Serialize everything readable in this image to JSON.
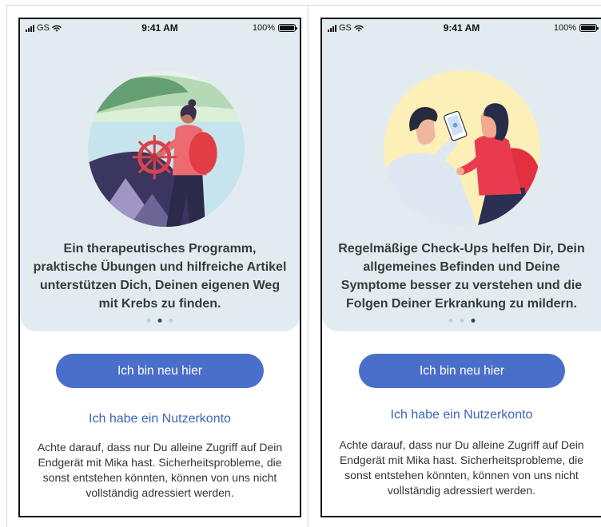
{
  "colors": {
    "accent": "#4a6fcb",
    "link": "#3f63ba",
    "card_background": "#e2ecf0",
    "dot_active": "#394755",
    "dot_inactive": "#c5cdd2",
    "text": "#3a3a3a"
  },
  "icons": {
    "signal": "signal-bars-icon",
    "wifi": "wifi-icon",
    "battery": "battery-icon"
  },
  "screens": [
    {
      "status_bar": {
        "carrier": "GS",
        "time": "9:41 AM",
        "battery": "100%"
      },
      "headline_lines": [
        "Ein therapeutisches Programm,",
        "praktische Übungen und hilfreiche Artikel",
        "unterstützen Dich, Deinen eigenen Weg",
        "mit Krebs zu finden."
      ],
      "page_indicator": {
        "count": 3,
        "active_page": 2
      },
      "primary_button": "Ich bin neu hier",
      "secondary_link": "Ich habe ein Nutzerkonto",
      "disclaimer_lines": [
        "Achte darauf, dass nur Du alleine Zugriff auf Dein",
        "Endgerät mit Mika hast. Sicherheitsprobleme, die",
        "sonst entstehen könnten, können von uns nicht",
        "vollständig adressiert werden."
      ]
    },
    {
      "status_bar": {
        "carrier": "GS",
        "time": "9:41 AM",
        "battery": "100%"
      },
      "headline_lines": [
        "Regelmäßige Check-Ups helfen Dir, Dein",
        "allgemeines Befinden und Deine",
        "Symptome besser zu verstehen und die",
        "Folgen Deiner Erkrankung zu mildern."
      ],
      "page_indicator": {
        "count": 3,
        "active_page": 3
      },
      "primary_button": "Ich bin neu hier",
      "secondary_link": "Ich habe ein Nutzerkonto",
      "disclaimer_lines": [
        "Achte darauf, dass nur Du alleine Zugriff auf Dein",
        "Endgerät mit Mika hast. Sicherheitsprobleme, die",
        "sonst entstehen könnten, können von uns nicht",
        "vollständig adressiert werden."
      ]
    }
  ]
}
